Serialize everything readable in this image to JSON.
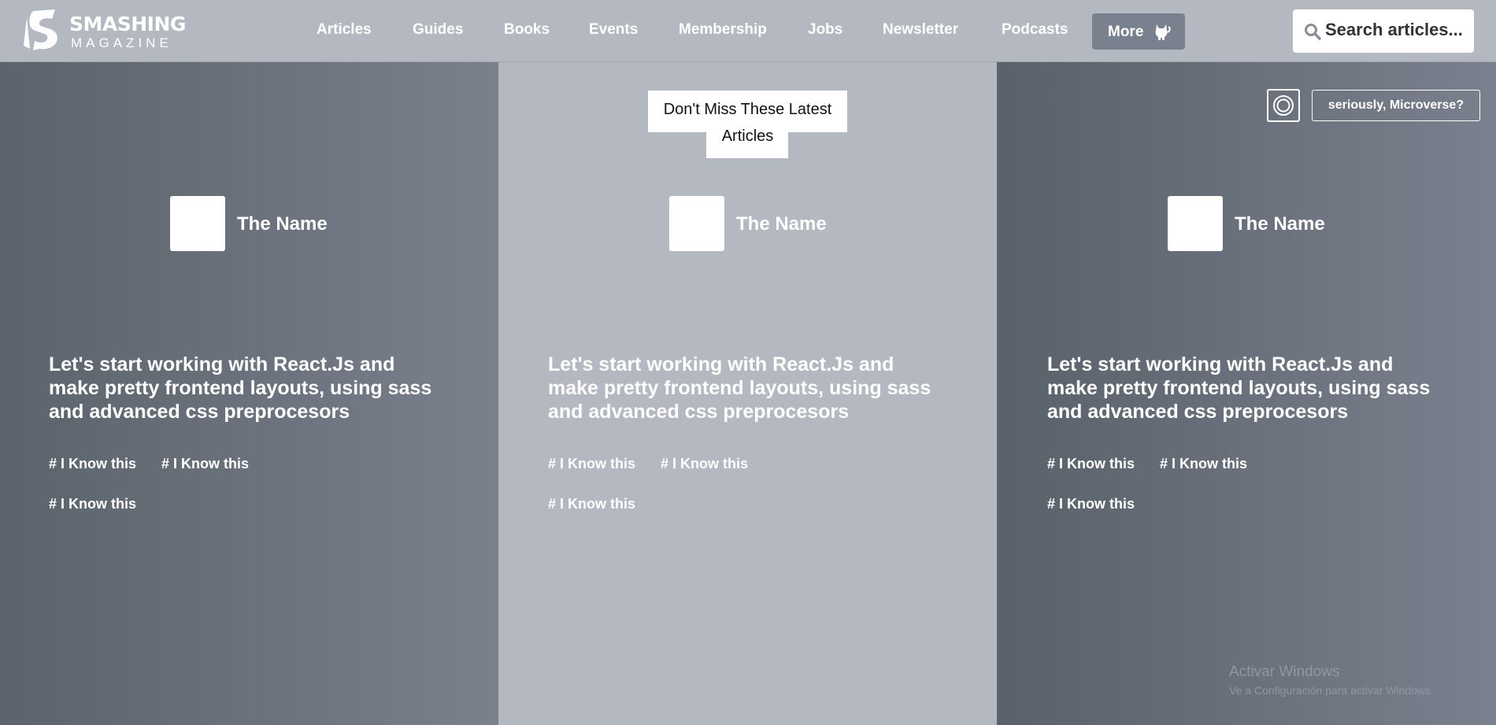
{
  "header": {
    "logo": {
      "line1": "SMASHING",
      "line2": "MAGAZINE"
    },
    "nav": [
      "Articles",
      "Guides",
      "Books",
      "Events",
      "Membership",
      "Jobs",
      "Newsletter",
      "Podcasts"
    ],
    "more_label": "More",
    "search_placeholder": "Search articles..."
  },
  "section": {
    "heading_line1": "Don't Miss These Latest",
    "heading_line2": "Articles",
    "circle_button_icon": "target-icon",
    "micro_button": "seriously, Microverse?"
  },
  "cards": [
    {
      "author": "The Name",
      "title": "Let's start working with React.Js and make pretty frontend layouts, using sass and advanced css preprocesors",
      "tags": [
        "# I Know this",
        "# I Know this",
        "# I Know this"
      ]
    },
    {
      "author": "The Name",
      "title": "Let's start working with React.Js and make pretty frontend layouts, using sass and advanced css preprocesors",
      "tags": [
        "# I Know this",
        "# I Know this",
        "# I Know this"
      ]
    },
    {
      "author": "The Name",
      "title": "Let's start working with React.Js and make pretty frontend layouts, using sass and advanced css preprocesors",
      "tags": [
        "# I Know this",
        "# I Know this",
        "# I Know this"
      ]
    }
  ],
  "watermark": {
    "title": "Activar Windows",
    "subtitle": "Ve a Configuración para activar Windows."
  },
  "colors": {
    "header_bg": "#b4b9c1",
    "more_button_bg": "#7a818e",
    "middle_column_bg": "#b4b8c1"
  }
}
